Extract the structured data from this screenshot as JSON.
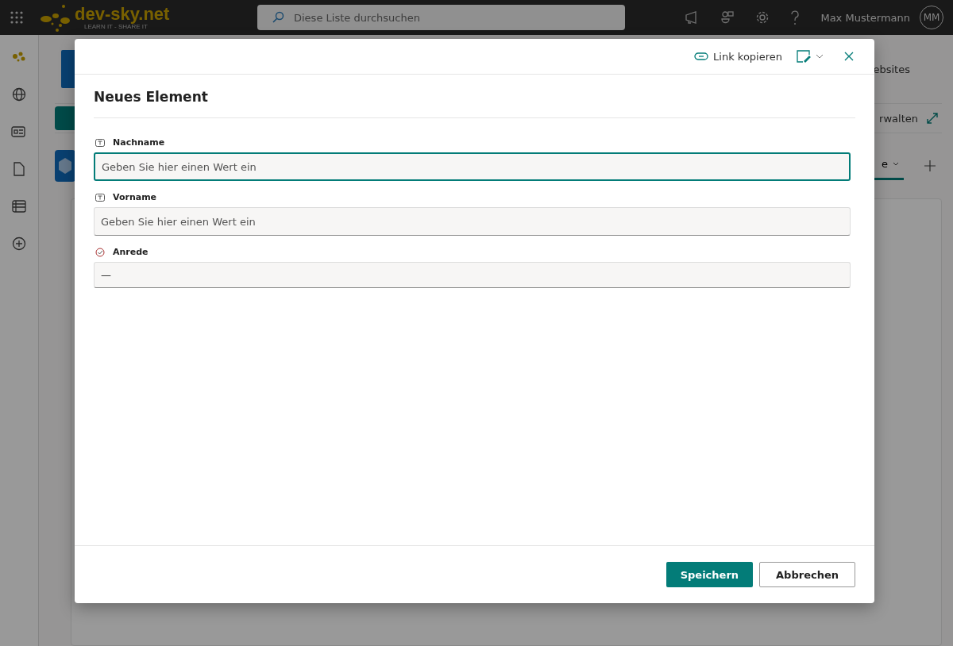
{
  "topbar": {
    "logo": {
      "name": "dev-sky.net",
      "tagline": "LEARN IT - SHARE IT"
    },
    "search": {
      "placeholder": "Diese Liste durchsuchen"
    },
    "user": {
      "name": "Max Mustermann",
      "initials": "MM"
    }
  },
  "background": {
    "header_text": "ebsites",
    "command_text": "rwalten",
    "tab": {
      "label": "e",
      "selected": true
    }
  },
  "dialog": {
    "toolbar": {
      "copy_link": "Link kopieren"
    },
    "title": "Neues Element",
    "fields": [
      {
        "kind": "text",
        "label": "Nachname",
        "placeholder": "Geben Sie hier einen Wert ein",
        "focused": true
      },
      {
        "kind": "text",
        "label": "Vorname",
        "placeholder": "Geben Sie hier einen Wert ein",
        "focused": false
      },
      {
        "kind": "choice",
        "label": "Anrede",
        "value": "—",
        "focused": false
      }
    ],
    "buttons": {
      "save": "Speichern",
      "cancel": "Abbrechen"
    }
  }
}
